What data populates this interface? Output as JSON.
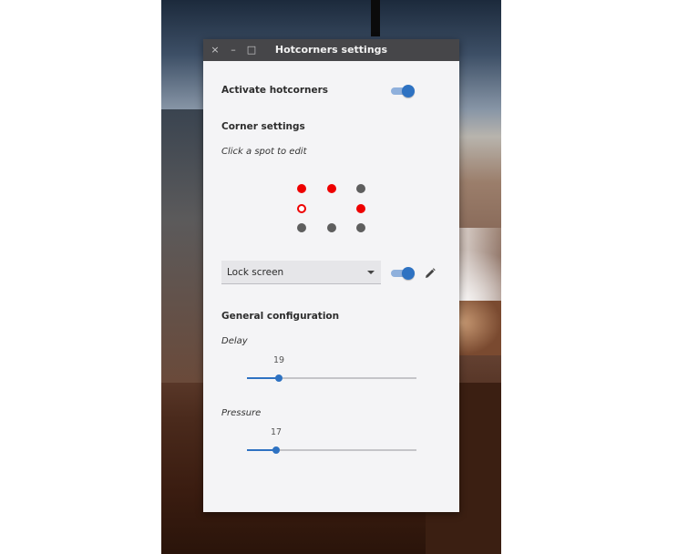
{
  "window": {
    "title": "Hotcorners settings",
    "controls": {
      "close": "×",
      "minimize": "–",
      "maximize": "□"
    }
  },
  "activate": {
    "label": "Activate hotcorners",
    "enabled": true
  },
  "corner_settings": {
    "title": "Corner settings",
    "hint": "Click a spot to edit",
    "grid": [
      [
        "red",
        "red",
        "grey"
      ],
      [
        "selected",
        "none",
        "red"
      ],
      [
        "grey",
        "grey",
        "grey"
      ]
    ],
    "action": {
      "selected": "Lock screen",
      "enabled": true,
      "edit_icon": "pencil-icon"
    }
  },
  "general": {
    "title": "General configuration",
    "delay": {
      "label": "Delay",
      "value": 19,
      "fraction": 0.19
    },
    "pressure": {
      "label": "Pressure",
      "value": 17,
      "fraction": 0.17
    }
  },
  "colors": {
    "accent": "#2e72c2",
    "active_spot": "#ee0000",
    "inactive_spot": "#5e5e5e",
    "titlebar": "#464649"
  }
}
